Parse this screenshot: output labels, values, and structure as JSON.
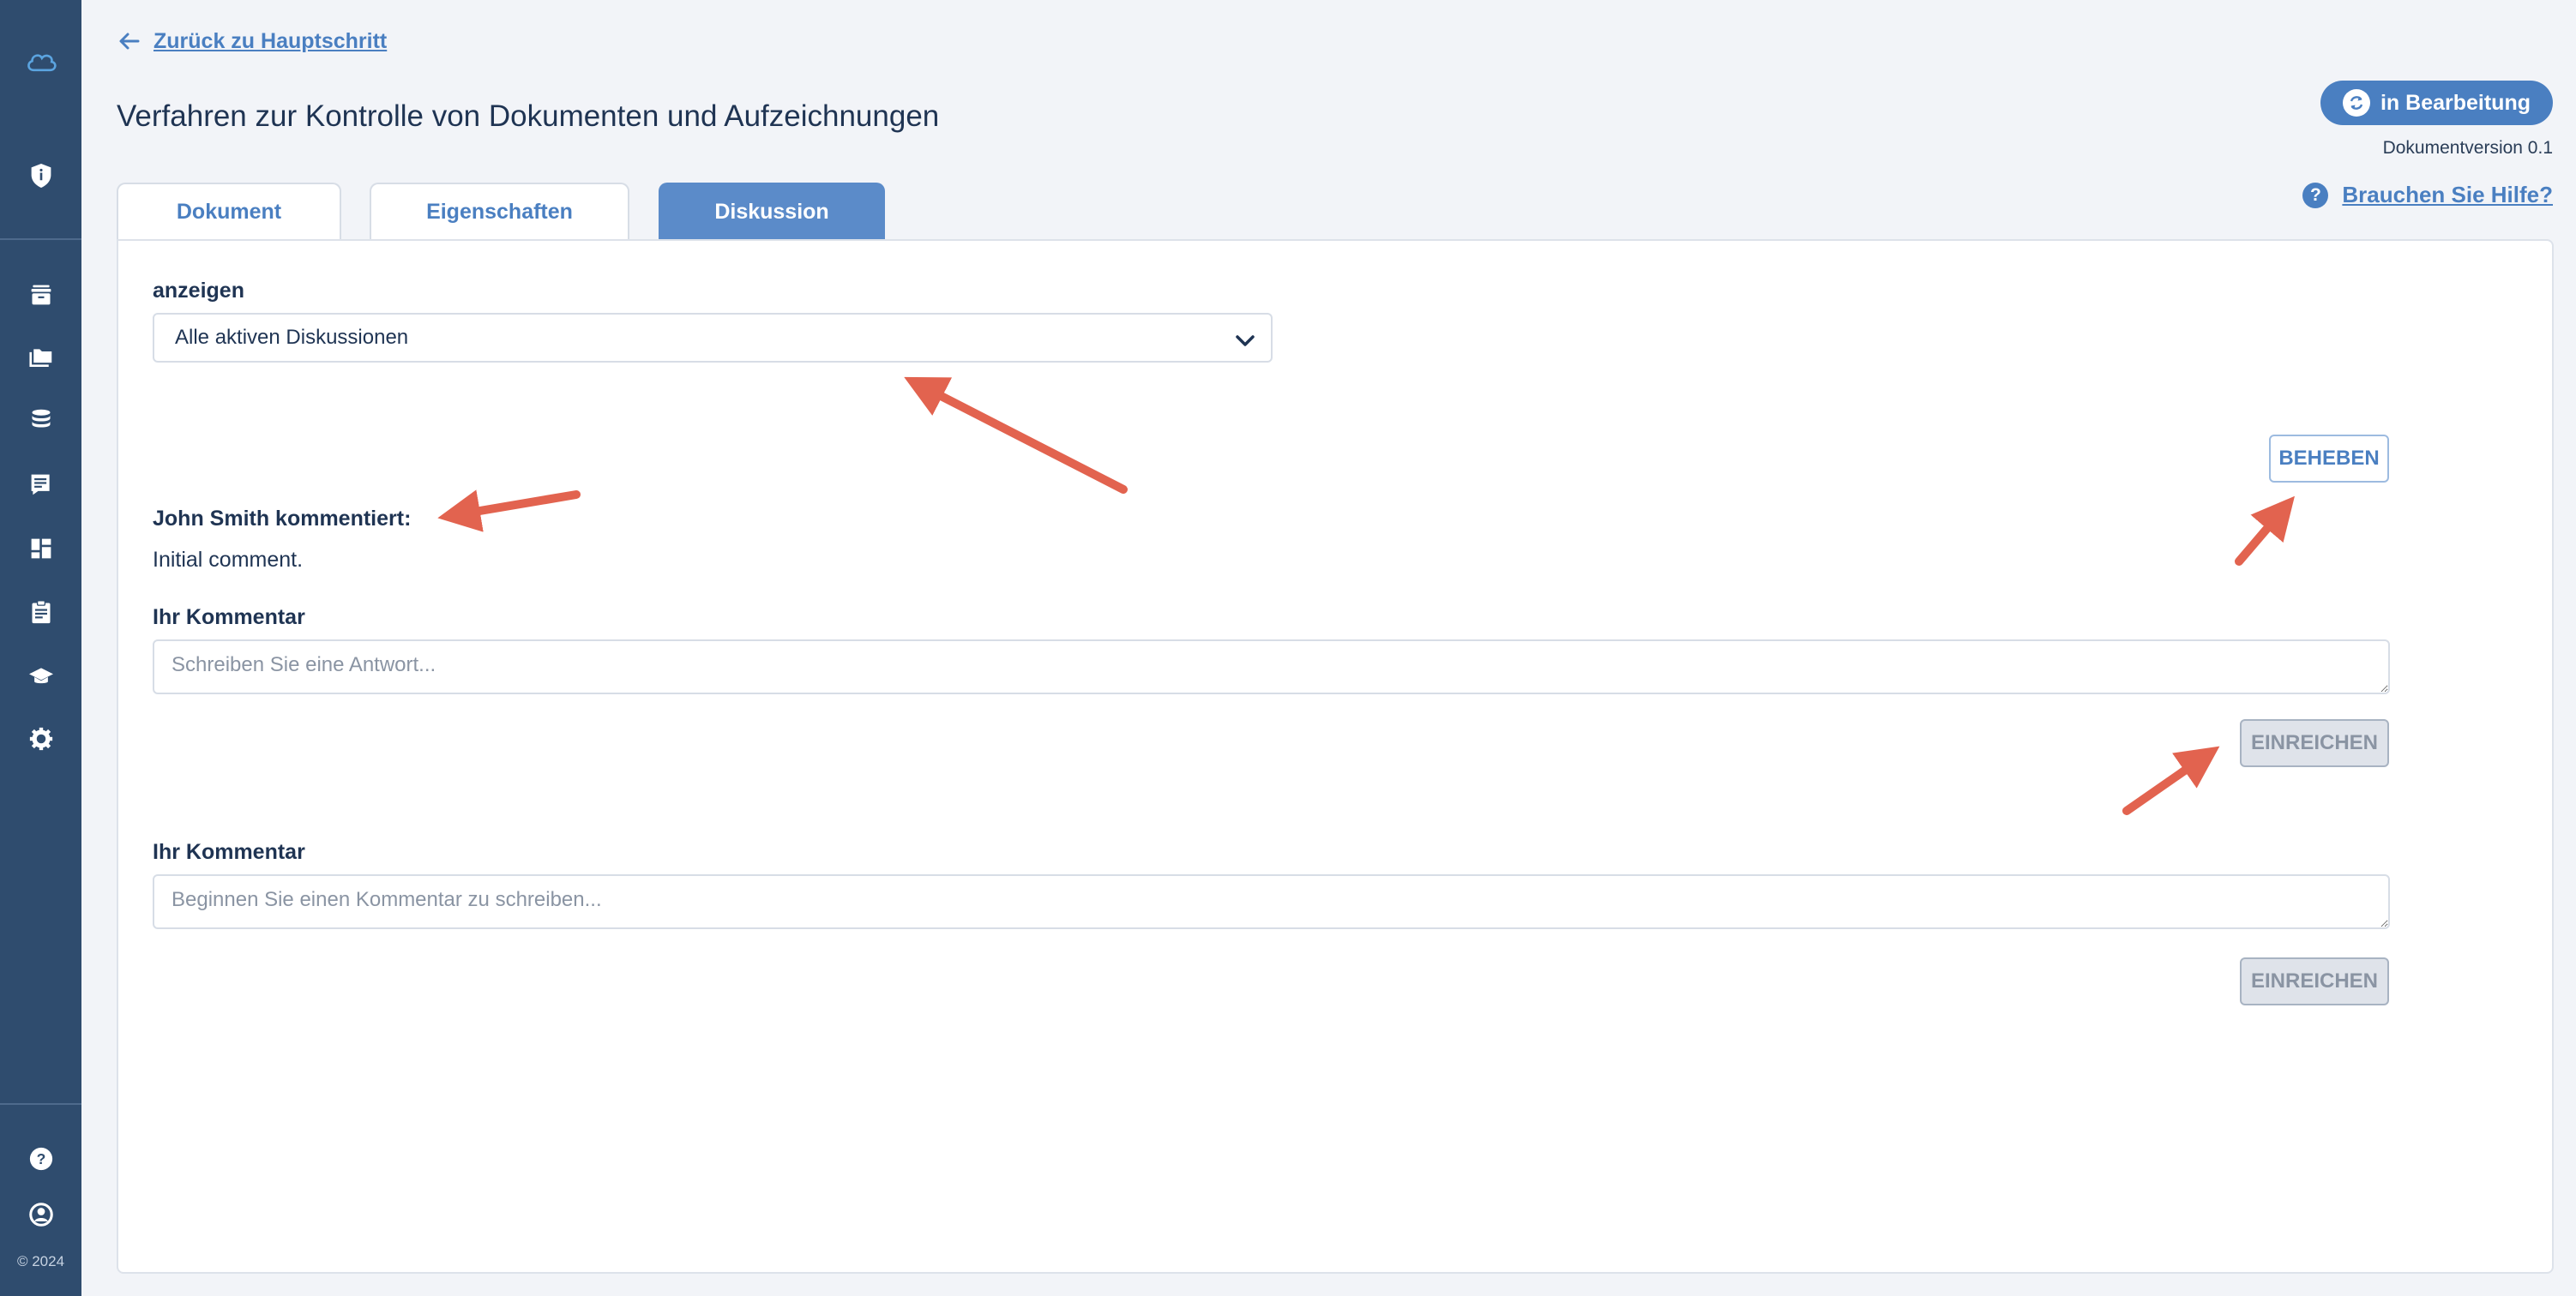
{
  "sidebar": {
    "icons": [
      "cloud-logo-icon",
      "shield-icon",
      "archive-icon",
      "folders-icon",
      "database-icon",
      "forum-icon",
      "dashboard-icon",
      "clipboard-icon",
      "graduation-cap-icon",
      "settings-gear-icon",
      "help-icon",
      "account-icon"
    ],
    "copyright": "© 2024"
  },
  "header": {
    "back_link": "Zurück zu Hauptschritt",
    "title": "Verfahren zur Kontrolle von Dokumenten und Aufzeichnungen",
    "status": "in Bearbeitung",
    "version": "Dokumentversion 0.1",
    "help": "Brauchen Sie Hilfe?"
  },
  "tabs": [
    {
      "label": "Dokument",
      "active": false
    },
    {
      "label": "Eigenschaften",
      "active": false
    },
    {
      "label": "Diskussion",
      "active": true
    }
  ],
  "discussion": {
    "filter_label": "anzeigen",
    "filter_value": "Alle aktiven Diskussionen",
    "resolve_button": "BEHEBEN",
    "comment_author": "John Smith kommentiert:",
    "comment_text": "Initial comment.",
    "reply": {
      "label": "Ihr Kommentar",
      "placeholder": "Schreiben Sie eine Antwort...",
      "submit": "EINREICHEN"
    },
    "new_comment": {
      "label": "Ihr Kommentar",
      "placeholder": "Beginnen Sie einen Kommentar zu schreiben...",
      "submit": "EINREICHEN"
    }
  },
  "colors": {
    "sidebar": "#2f4c6e",
    "accent": "#4a7fc1",
    "annotation_arrow": "#e2634f"
  }
}
